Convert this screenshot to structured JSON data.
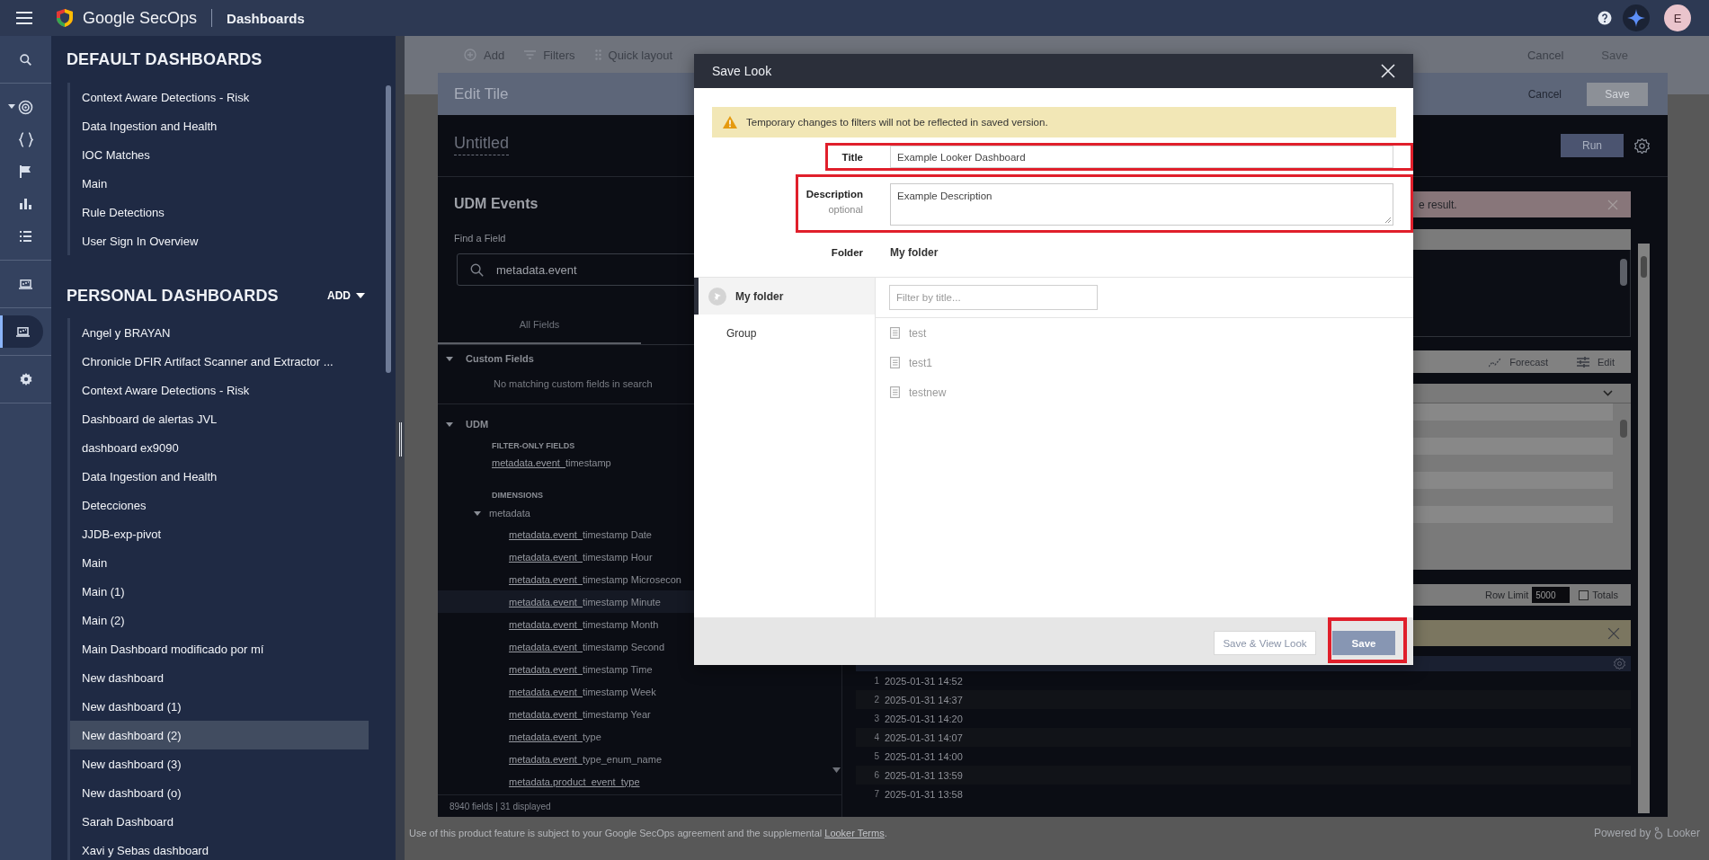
{
  "topbar": {
    "product": "Google SecOps",
    "section": "Dashboards",
    "avatar": "E"
  },
  "rail_groups": [
    [
      {
        "kind": "search",
        "selected": false,
        "caret": false
      }
    ],
    [
      {
        "kind": "radar",
        "selected": false,
        "caret": true
      },
      {
        "kind": "braces",
        "selected": false,
        "caret": false
      },
      {
        "kind": "flag",
        "selected": false,
        "caret": false
      },
      {
        "kind": "chart",
        "selected": false,
        "caret": false
      },
      {
        "kind": "list",
        "selected": false,
        "caret": false
      }
    ],
    [
      {
        "kind": "dashboard",
        "selected": false,
        "caret": false
      }
    ],
    [
      {
        "kind": "dashboard",
        "selected": true,
        "caret": false
      }
    ],
    [
      {
        "kind": "settings",
        "selected": false,
        "caret": false
      }
    ]
  ],
  "default_dashboards": {
    "heading": "DEFAULT DASHBOARDS",
    "items": [
      {
        "label": "Context Aware Detections - Risk",
        "selected": false
      },
      {
        "label": "Data Ingestion and Health",
        "selected": false
      },
      {
        "label": "IOC Matches",
        "selected": false
      },
      {
        "label": "Main",
        "selected": false
      },
      {
        "label": "Rule Detections",
        "selected": false
      },
      {
        "label": "User Sign In Overview",
        "selected": false
      }
    ]
  },
  "personal_dashboards": {
    "heading": "PERSONAL DASHBOARDS",
    "add": "ADD",
    "items": [
      {
        "label": "Angel y BRAYAN",
        "selected": false
      },
      {
        "label": "Chronicle DFIR Artifact Scanner and Extractor ...",
        "selected": false
      },
      {
        "label": "Context Aware Detections - Risk",
        "selected": false
      },
      {
        "label": "Dashboard de alertas JVL",
        "selected": false
      },
      {
        "label": "dashboard ex9090",
        "selected": false
      },
      {
        "label": "Data Ingestion and Health",
        "selected": false
      },
      {
        "label": "Detecciones",
        "selected": false
      },
      {
        "label": "JJDB-exp-pivot",
        "selected": false
      },
      {
        "label": "Main",
        "selected": false
      },
      {
        "label": "Main (1)",
        "selected": false
      },
      {
        "label": "Main (2)",
        "selected": false
      },
      {
        "label": "Main Dashboard modificado por mí",
        "selected": false
      },
      {
        "label": "New dashboard",
        "selected": false
      },
      {
        "label": "New dashboard (1)",
        "selected": false
      },
      {
        "label": "New dashboard (2)",
        "selected": true
      },
      {
        "label": "New dashboard (3)",
        "selected": false
      },
      {
        "label": "New dashboard (o)",
        "selected": false
      },
      {
        "label": "Sarah Dashboard",
        "selected": false
      },
      {
        "label": "Xavi y Sebas dashboard",
        "selected": false
      }
    ]
  },
  "page_toolbar": {
    "add": "Add",
    "filters": "Filters",
    "quick_layout": "Quick layout",
    "cancel": "Cancel",
    "save": "Save"
  },
  "edit_tile": {
    "title": "Edit Tile",
    "cancel": "Cancel",
    "save": "Save",
    "name": "Untitled",
    "run": "Run",
    "explore": "UDM Events",
    "find_label": "Find a Field",
    "search_value": "metadata.event",
    "tabs": [
      {
        "label": "All Fields",
        "selected": true
      }
    ],
    "custom_fields": {
      "label": "Custom Fields",
      "expanded": true,
      "empty": "No matching custom fields in search"
    },
    "udm": {
      "label": "UDM",
      "expanded": true,
      "filter_heading": "FILTER-ONLY FIELDS",
      "filter_fields": [
        {
          "match": "metadata.event_",
          "rest": "timestamp",
          "highlighted": false
        }
      ],
      "dim_heading": "DIMENSIONS",
      "group": {
        "label": "metadata",
        "expanded": true,
        "fields": [
          {
            "match": "metadata.event_",
            "rest": "timestamp Date",
            "highlighted": false
          },
          {
            "match": "metadata.event_",
            "rest": "timestamp Hour",
            "highlighted": false
          },
          {
            "match": "metadata.event_",
            "rest": "timestamp Microsecon",
            "highlighted": false
          },
          {
            "match": "metadata.event_",
            "rest": "timestamp Minute",
            "highlighted": true
          },
          {
            "match": "metadata.event_",
            "rest": "timestamp Month",
            "highlighted": false
          },
          {
            "match": "metadata.event_",
            "rest": "timestamp Second",
            "highlighted": false
          },
          {
            "match": "metadata.event_",
            "rest": "timestamp Time",
            "highlighted": false
          },
          {
            "match": "metadata.event_",
            "rest": "timestamp Week",
            "highlighted": false
          },
          {
            "match": "metadata.event_",
            "rest": "timestamp Year",
            "highlighted": false
          },
          {
            "match": "metadata.event_",
            "rest": "type",
            "highlighted": false
          },
          {
            "match": "metadata.event_",
            "rest": "type_enum_name",
            "highlighted": false
          },
          {
            "match": "metadata.product_event_type",
            "highlighted": false
          }
        ]
      }
    },
    "field_count": "8940 fields | 31 displayed",
    "error_text": "e result.",
    "viz_actions": [
      {
        "kind": "forecast",
        "label": "Forecast"
      },
      {
        "kind": "edit",
        "label": "Edit"
      }
    ],
    "row_limit_label": "Row Limit",
    "row_limit": "5000",
    "totals": {
      "label": "Totals",
      "checked": false
    },
    "results": [
      {
        "index": "1",
        "value": "2025-01-31 14:52"
      },
      {
        "index": "2",
        "value": "2025-01-31 14:37"
      },
      {
        "index": "3",
        "value": "2025-01-31 14:20"
      },
      {
        "index": "4",
        "value": "2025-01-31 14:07"
      },
      {
        "index": "5",
        "value": "2025-01-31 14:00"
      },
      {
        "index": "6",
        "value": "2025-01-31 13:59"
      },
      {
        "index": "7",
        "value": "2025-01-31 13:58"
      }
    ]
  },
  "dialog": {
    "title": "Save Look",
    "warning": "Temporary changes to filters will not be reflected in saved version.",
    "fields": [
      {
        "kind": "input",
        "label": "Title",
        "value": "Example Looker Dashboard",
        "highlighted": true
      },
      {
        "kind": "textarea",
        "label": "Description",
        "hint": "optional",
        "value": "Example Description",
        "highlighted": true
      },
      {
        "kind": "static",
        "label": "Folder",
        "value": "My folder",
        "highlighted": false
      }
    ],
    "nav": [
      {
        "label": "My folder",
        "selected": true,
        "icon": true
      },
      {
        "label": "Group",
        "selected": false,
        "icon": false
      }
    ],
    "filter_placeholder": "Filter by title...",
    "items": [
      "test",
      "test1",
      "testnew"
    ],
    "buttons": [
      {
        "kind": "secondary",
        "label": "Save & View Look",
        "highlighted": false
      },
      {
        "kind": "primary",
        "label": "Save",
        "highlighted": true
      }
    ]
  },
  "footer": {
    "notice": "Use of this product feature is subject to your Google SecOps agreement and the supplemental",
    "link": "Looker Terms",
    "notice_end": ".",
    "powered_by": "Powered by",
    "brand": "Looker"
  }
}
